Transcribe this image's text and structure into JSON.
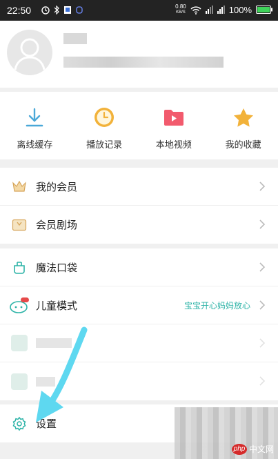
{
  "status_bar": {
    "time": "22:50",
    "net_speed_value": "0.80",
    "net_speed_unit": "KB/S",
    "battery": "100%"
  },
  "profile": {
    "name": "",
    "subtitle": ""
  },
  "quick_actions": [
    {
      "label": "离线缓存",
      "icon": "download-icon"
    },
    {
      "label": "播放记录",
      "icon": "clock-icon"
    },
    {
      "label": "本地视频",
      "icon": "folder-video-icon"
    },
    {
      "label": "我的收藏",
      "icon": "star-icon"
    }
  ],
  "menu_group_1": [
    {
      "label": "我的会员",
      "icon": "crown-icon"
    },
    {
      "label": "会员剧场",
      "icon": "vip-theater-icon"
    }
  ],
  "menu_group_2": [
    {
      "label": "魔法口袋",
      "icon": "magic-pocket-icon"
    },
    {
      "label": "儿童模式",
      "icon": "kids-mode-icon",
      "hint": "宝宝开心妈妈放心"
    }
  ],
  "settings": {
    "label": "设置",
    "icon": "gear-icon"
  },
  "watermark": {
    "logo": "php",
    "text": "中文网"
  },
  "colors": {
    "accent_teal": "#2cb3a7",
    "icon_blue": "#4aa8d8",
    "icon_yellow": "#f2b23a",
    "icon_red": "#f25a6d",
    "arrow_cyan": "#5ed8f0"
  }
}
